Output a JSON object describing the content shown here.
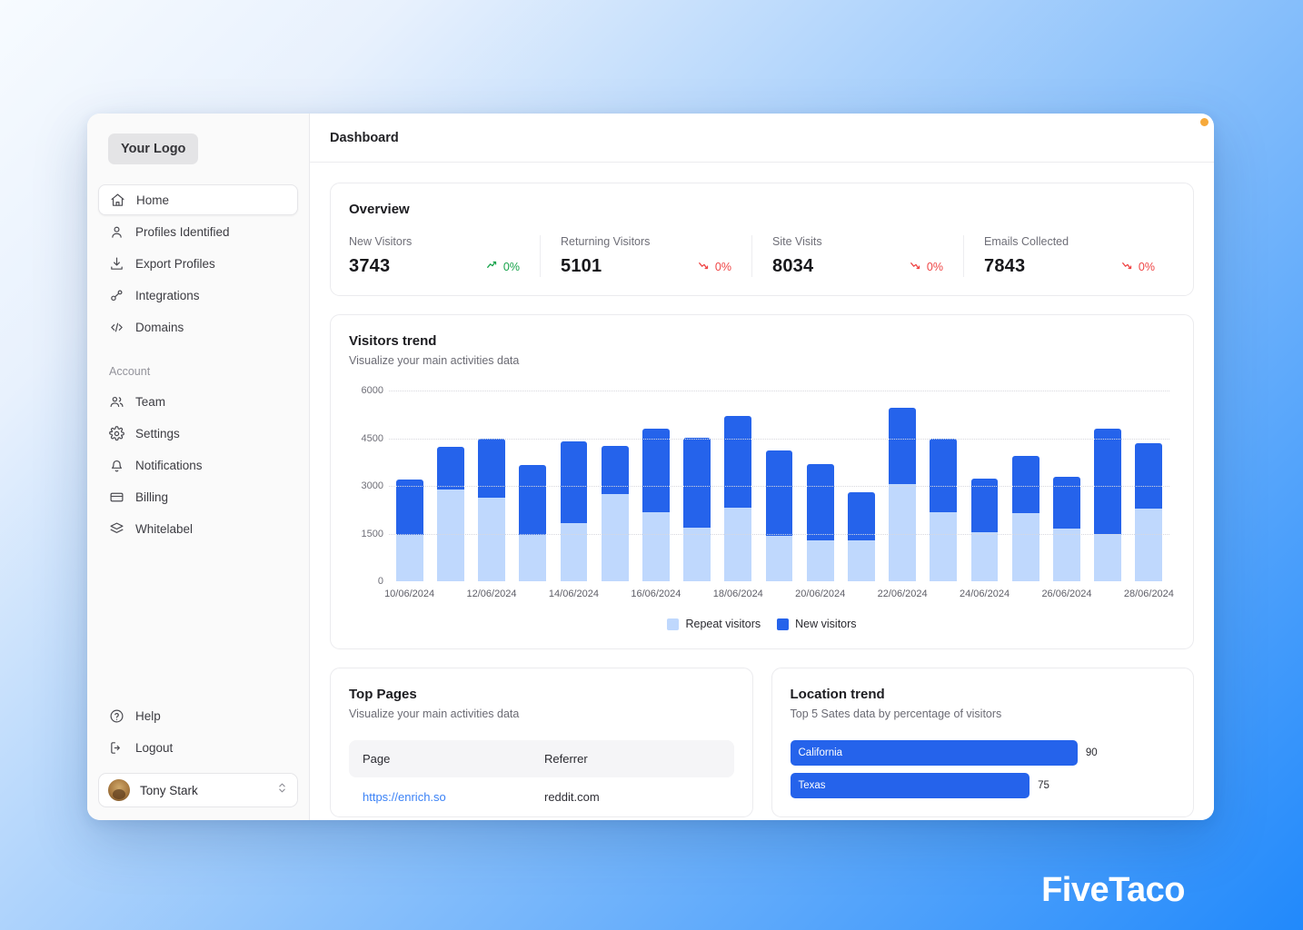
{
  "brand": {
    "watermark": "FiveTaco"
  },
  "sidebar": {
    "logo": "Your Logo",
    "nav": [
      {
        "label": "Home",
        "icon": "home-icon",
        "active": true
      },
      {
        "label": "Profiles Identified",
        "icon": "user-icon",
        "active": false
      },
      {
        "label": "Export Profiles",
        "icon": "download-icon",
        "active": false
      },
      {
        "label": "Integrations",
        "icon": "integrations-icon",
        "active": false
      },
      {
        "label": "Domains",
        "icon": "code-icon",
        "active": false
      }
    ],
    "account_label": "Account",
    "account_nav": [
      {
        "label": "Team",
        "icon": "users-icon"
      },
      {
        "label": "Settings",
        "icon": "gear-icon"
      },
      {
        "label": "Notifications",
        "icon": "bell-icon"
      },
      {
        "label": "Billing",
        "icon": "credit-card-icon"
      },
      {
        "label": "Whitelabel",
        "icon": "layers-icon"
      }
    ],
    "footer_nav": [
      {
        "label": "Help",
        "icon": "help-circle-icon"
      },
      {
        "label": "Logout",
        "icon": "logout-icon"
      }
    ],
    "profile": {
      "name": "Tony Stark",
      "avatar": "user-avatar",
      "chevron": "chevrons-up-down-icon"
    }
  },
  "header": {
    "title": "Dashboard"
  },
  "overview": {
    "title": "Overview",
    "stats": [
      {
        "label": "New Visitors",
        "value": "3743",
        "delta": "0%",
        "direction": "up"
      },
      {
        "label": "Returning Visitors",
        "value": "5101",
        "delta": "0%",
        "direction": "down"
      },
      {
        "label": "Site Visits",
        "value": "8034",
        "delta": "0%",
        "direction": "down"
      },
      {
        "label": "Emails Collected",
        "value": "7843",
        "delta": "0%",
        "direction": "down"
      }
    ]
  },
  "visitors_trend": {
    "title": "Visitors trend",
    "subtitle": "Visualize your main activities data"
  },
  "top_pages": {
    "title": "Top Pages",
    "subtitle": "Visualize your main activities data",
    "columns": [
      "Page",
      "Referrer"
    ],
    "rows": [
      {
        "page": "https://enrich.so",
        "referrer": "reddit.com"
      }
    ]
  },
  "location_trend": {
    "title": "Location trend",
    "subtitle": "Top 5 Sates data by percentage of visitors",
    "max": 100,
    "rows": [
      {
        "label": "California",
        "value": 90
      },
      {
        "label": "Texas",
        "value": 75
      }
    ]
  },
  "colors": {
    "new_visitors": "#2563eb",
    "repeat_visitors": "#bfd8fd",
    "up": "#16a34a",
    "down": "#ef4444",
    "accent": "#2563eb",
    "notification_dot": "#f6a93b"
  },
  "chart_data": {
    "type": "bar",
    "title": "Visitors trend",
    "subtitle": "Visualize your main activities data",
    "stacked": true,
    "xlabel": "",
    "ylabel": "",
    "ylim": [
      0,
      6000
    ],
    "yticks": [
      0,
      1500,
      3000,
      4500,
      6000
    ],
    "grid": true,
    "legend_position": "bottom",
    "legend": [
      "Repeat visitors",
      "New visitors"
    ],
    "categories": [
      "10/06/2024",
      "11/06/2024",
      "12/06/2024",
      "13/06/2024",
      "14/06/2024",
      "15/06/2024",
      "16/06/2024",
      "17/06/2024",
      "18/06/2024",
      "19/06/2024",
      "20/06/2024",
      "21/06/2024",
      "22/06/2024",
      "23/06/2024",
      "24/06/2024",
      "25/06/2024",
      "26/06/2024",
      "27/06/2024",
      "28/06/2024"
    ],
    "tick_labels": [
      "10/06/2024",
      "12/06/2024",
      "14/06/2024",
      "16/06/2024",
      "18/06/2024",
      "20/06/2024",
      "22/06/2024",
      "24/06/2024",
      "26/06/2024",
      "28/06/2024"
    ],
    "series": [
      {
        "name": "Repeat visitors",
        "color": "#bfd8fd",
        "values": [
          1470,
          2900,
          2620,
          1450,
          1840,
          2730,
          2160,
          1700,
          2320,
          1430,
          1280,
          1280,
          3050,
          2180,
          1530,
          2150,
          1660,
          1500,
          2280
        ]
      },
      {
        "name": "New visitors",
        "color": "#2563eb",
        "values": [
          1720,
          1320,
          1870,
          2220,
          2560,
          1540,
          2640,
          2810,
          2870,
          2680,
          2410,
          1530,
          2400,
          2320,
          1690,
          1780,
          1630,
          3290,
          2060
        ]
      }
    ],
    "totals": [
      3190,
      4220,
      4490,
      3670,
      4400,
      4270,
      4800,
      4510,
      5190,
      4110,
      3690,
      2810,
      5450,
      4500,
      3220,
      3930,
      3290,
      4790,
      4340
    ]
  }
}
